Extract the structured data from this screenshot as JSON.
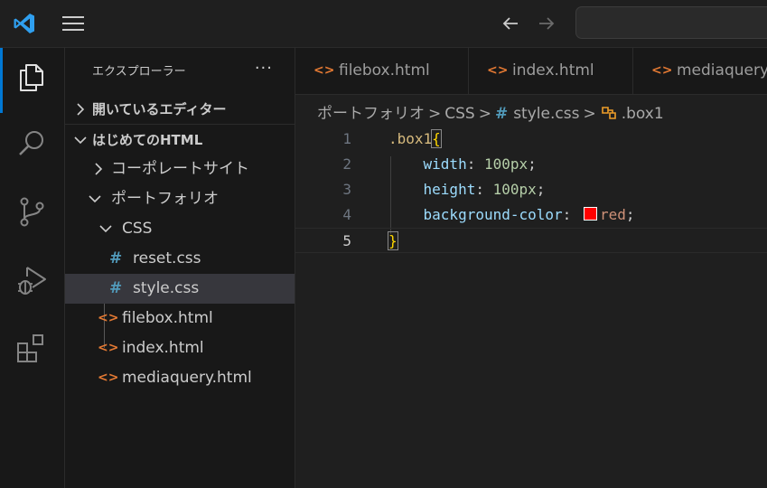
{
  "titlebar": {
    "search_placeholder": ""
  },
  "sidebar": {
    "title": "エクスプローラー",
    "more": "···",
    "open_editors": "開いているエディター",
    "folder_root": "はじめてのHTML",
    "tree": {
      "corporate": "コーポレートサイト",
      "portfolio": "ポートフォリオ",
      "css_folder": "CSS",
      "reset_css": "reset.css",
      "style_css": "style.css",
      "filebox": "filebox.html",
      "index": "index.html",
      "mediaquery": "mediaquery.html"
    }
  },
  "tabs": [
    {
      "label": "filebox.html"
    },
    {
      "label": "index.html"
    },
    {
      "label": "mediaquery.html"
    }
  ],
  "breadcrumb": {
    "folder": "ポートフォリオ",
    "sub": "CSS",
    "file": "style.css",
    "symbol": ".box1"
  },
  "code": {
    "line_numbers": [
      "1",
      "2",
      "3",
      "4",
      "5"
    ],
    "l1_selector": ".box1",
    "l1_brace": "{",
    "l2_prop": "width",
    "l2_value": "100px",
    "l3_prop": "height",
    "l3_value": "100px",
    "l4_prop": "background-color",
    "l4_value": "red",
    "l5_brace": "}",
    "colon": ":",
    "semi": ";"
  },
  "colors": {
    "accent": "#0078d4",
    "swatch": "#ff0000",
    "html_icon": "#e37933",
    "css_icon": "#519aba"
  }
}
